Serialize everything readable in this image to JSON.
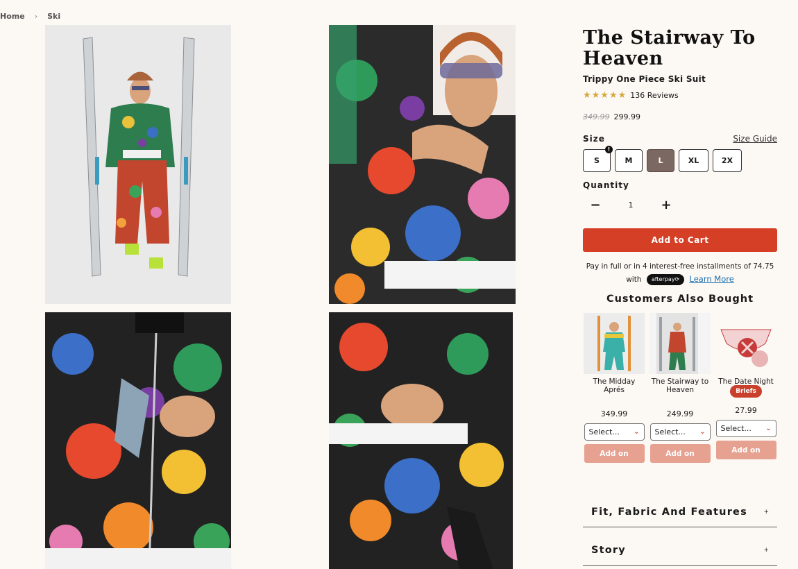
{
  "breadcrumb": {
    "home": "Home",
    "separator": "›",
    "current": "Ski"
  },
  "product": {
    "title": "The Stairway To Heaven",
    "subtitle": "Trippy One Piece Ski Suit",
    "rating": {
      "stars": "★★★★★",
      "value": 5,
      "reviews": "136 Reviews"
    },
    "old_price": "349.99",
    "price": "299.99"
  },
  "size": {
    "label": "Size",
    "guide": "Size Guide",
    "options": [
      "S",
      "M",
      "L",
      "XL",
      "2X"
    ],
    "selected": "L",
    "alert_badge": "!"
  },
  "quantity": {
    "label": "Quantity",
    "minus": "−",
    "value": "1",
    "plus": "+"
  },
  "cart": {
    "button": "Add to Cart"
  },
  "afterpay": {
    "line1": "Pay in full or in 4 interest-free installments of 74.75",
    "with": "with",
    "badge": "afterpay⟳",
    "learn_more": "Learn More"
  },
  "also_bought": {
    "heading": "Customers Also Bought",
    "items": [
      {
        "name": "The Midday Aprés",
        "tag": "",
        "price": "349.99",
        "select": "Select...",
        "addon": "Add on"
      },
      {
        "name": "The Stairway to Heaven",
        "tag": "",
        "price": "249.99",
        "select": "Select...",
        "addon": "Add on"
      },
      {
        "name": "The Date Night",
        "tag": "Briefs",
        "price": "27.99",
        "select": "Select...",
        "addon": "Add on"
      }
    ]
  },
  "accordion": [
    {
      "label": "Fit, Fabric And Features",
      "icon": "+"
    },
    {
      "label": "Story",
      "icon": "+"
    }
  ],
  "colors": {
    "accent": "#d43f26",
    "addon": "#e6a191",
    "selected_size": "#7b6863",
    "stars": "#d4a73c",
    "background": "#fcf8f3"
  }
}
